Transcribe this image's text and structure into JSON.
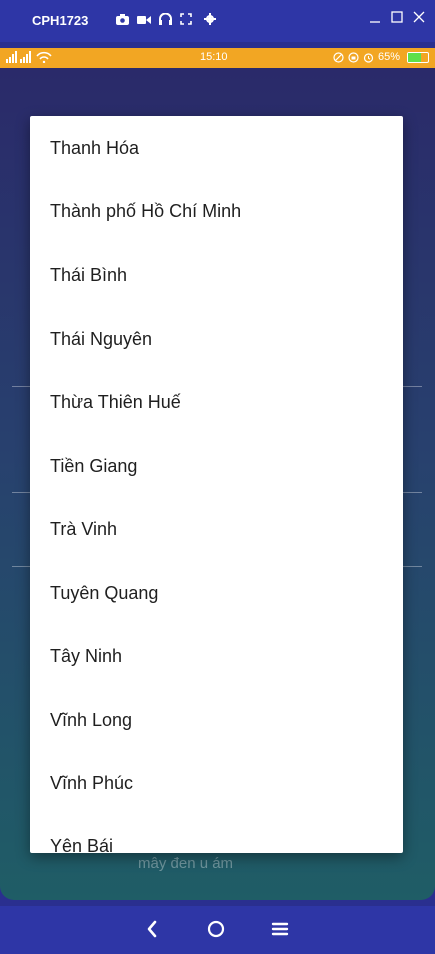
{
  "titlebar": {
    "device_name": "CPH1723",
    "icons": [
      "camera-icon",
      "video-icon",
      "headset-icon",
      "fullscreen-icon",
      "settings-icon"
    ],
    "controls": [
      "minimize-icon",
      "maximize-icon",
      "close-icon"
    ]
  },
  "statusbar": {
    "signal": "📶📶",
    "time": "15:10",
    "battery_percent_label": "65%",
    "battery_level": 0.65
  },
  "background": {
    "hint_text": "mây đen u ám"
  },
  "dialog": {
    "options": [
      "Thanh Hóa",
      "Thành phố Hồ Chí Minh",
      "Thái Bình",
      "Thái Nguyên",
      "Thừa Thiên Huế",
      "Tiền Giang",
      "Trà Vinh",
      "Tuyên Quang",
      "Tây Ninh",
      "Vĩnh Long",
      "Vĩnh Phúc",
      "Yên Bái"
    ]
  },
  "navbar": {
    "back": "‹",
    "home": "○",
    "menu": "≡"
  },
  "colors": {
    "titlebar": "#2e36a6",
    "statusbar": "#f2a623",
    "dialog": "#ffffff",
    "battery": "#5ee04a"
  }
}
